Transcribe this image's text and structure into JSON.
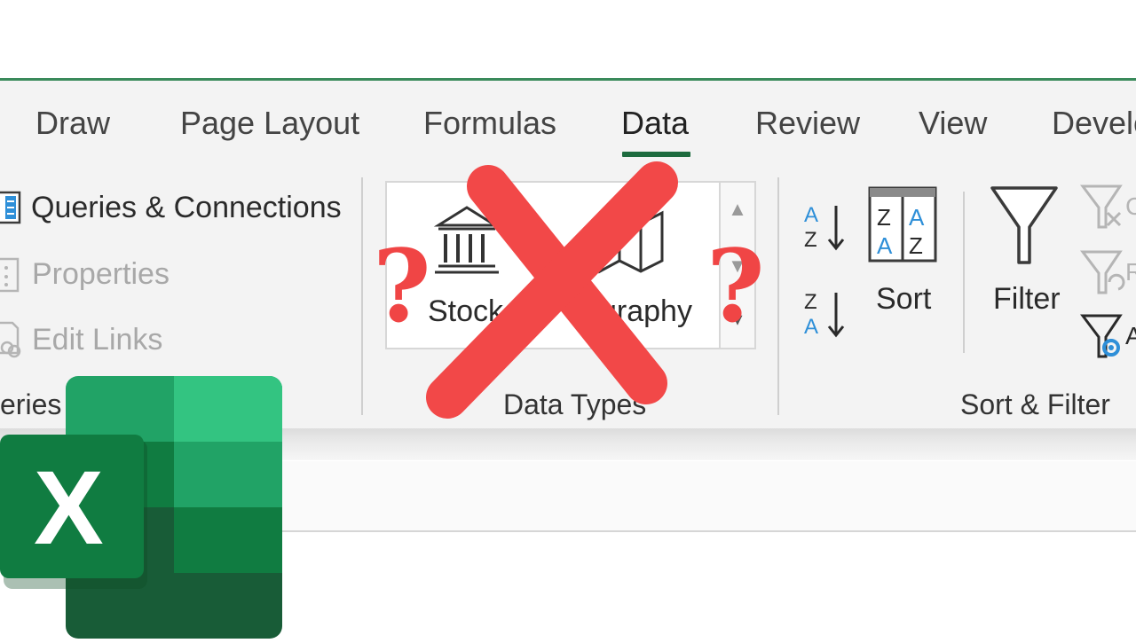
{
  "ribbon": {
    "tabs": [
      {
        "label": "Draw",
        "active": false
      },
      {
        "label": "Page Layout",
        "active": false
      },
      {
        "label": "Formulas",
        "active": false
      },
      {
        "label": "Data",
        "active": true
      },
      {
        "label": "Review",
        "active": false
      },
      {
        "label": "View",
        "active": false
      },
      {
        "label": "Develo",
        "active": false
      }
    ],
    "queries_group": {
      "label": "eries",
      "queries_connections": "Queries & Connections",
      "properties": "Properties",
      "edit_links": "Edit Links"
    },
    "data_types_group": {
      "label": "Data Types",
      "stocks_label": "Stock",
      "geography_label": "graphy"
    },
    "sort_filter_group": {
      "label": "Sort & Filter",
      "sort_label": "Sort",
      "filter_label": "Filter"
    }
  },
  "overlay": {
    "question_mark": "?",
    "cross_color": "#f24848",
    "question_color": "#f04545"
  },
  "colors": {
    "excel_green_dark": "#185c37",
    "excel_green": "#107c41",
    "excel_green_light": "#21a366",
    "excel_green_lighter": "#33c481",
    "accent_underline": "#1d6b3e",
    "sort_blue": "#2e8fd8"
  },
  "logo": {
    "letter": "X"
  }
}
